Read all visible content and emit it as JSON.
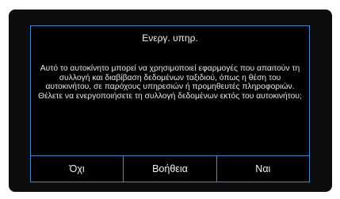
{
  "dialog": {
    "title": "Ενεργ. υπηρ.",
    "message": "Αυτό το αυτοκίνητο μπορεί να χρησιμοποιεί εφαρμογές που απαιτούν τη συλλογή και διαβίβαση δεδομένων ταξιδιού, όπως η θέση του αυτοκινήτου, σε παρόχους υπηρεσιών ή προμηθευτές πληροφοριών. Θέλετε να ενεργοποιήσετε τη συλλογή δεδομένων εκτός του αυτοκινήτου;",
    "buttons": {
      "no": "Όχι",
      "help": "Βοήθεια",
      "yes": "Ναι"
    }
  },
  "colors": {
    "background": "#0d0d0d",
    "border": "#4f86c6",
    "text": "#f2f2f2"
  }
}
